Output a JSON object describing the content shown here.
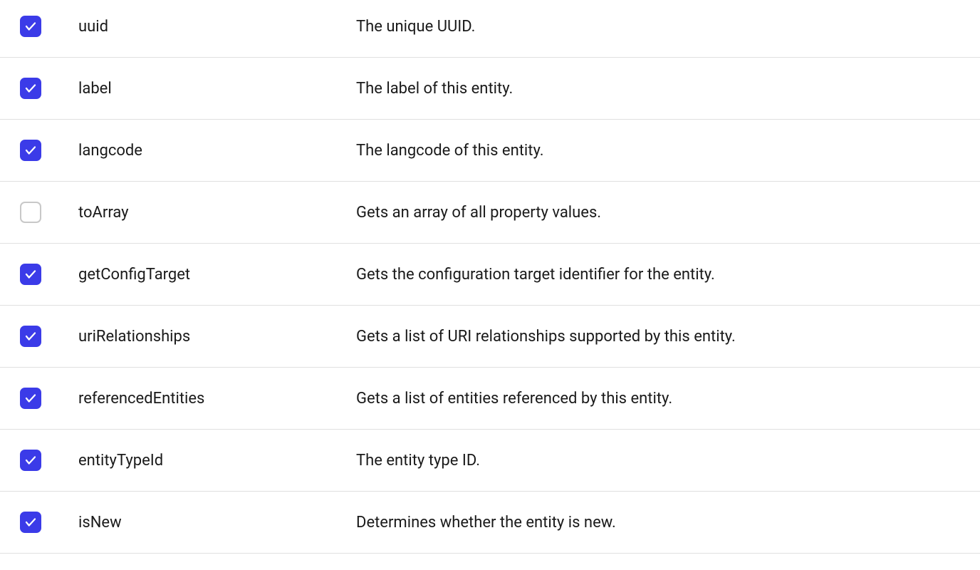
{
  "rows": [
    {
      "checked": true,
      "name": "uuid",
      "description": "The unique UUID."
    },
    {
      "checked": true,
      "name": "label",
      "description": "The label of this entity."
    },
    {
      "checked": true,
      "name": "langcode",
      "description": "The langcode of this entity."
    },
    {
      "checked": false,
      "name": "toArray",
      "description": "Gets an array of all property values."
    },
    {
      "checked": true,
      "name": "getConfigTarget",
      "description": "Gets the configuration target identifier for the entity."
    },
    {
      "checked": true,
      "name": "uriRelationships",
      "description": "Gets a list of URI relationships supported by this entity."
    },
    {
      "checked": true,
      "name": "referencedEntities",
      "description": "Gets a list of entities referenced by this entity."
    },
    {
      "checked": true,
      "name": "entityTypeId",
      "description": "The entity type ID."
    },
    {
      "checked": true,
      "name": "isNew",
      "description": "Determines whether the entity is new."
    }
  ]
}
